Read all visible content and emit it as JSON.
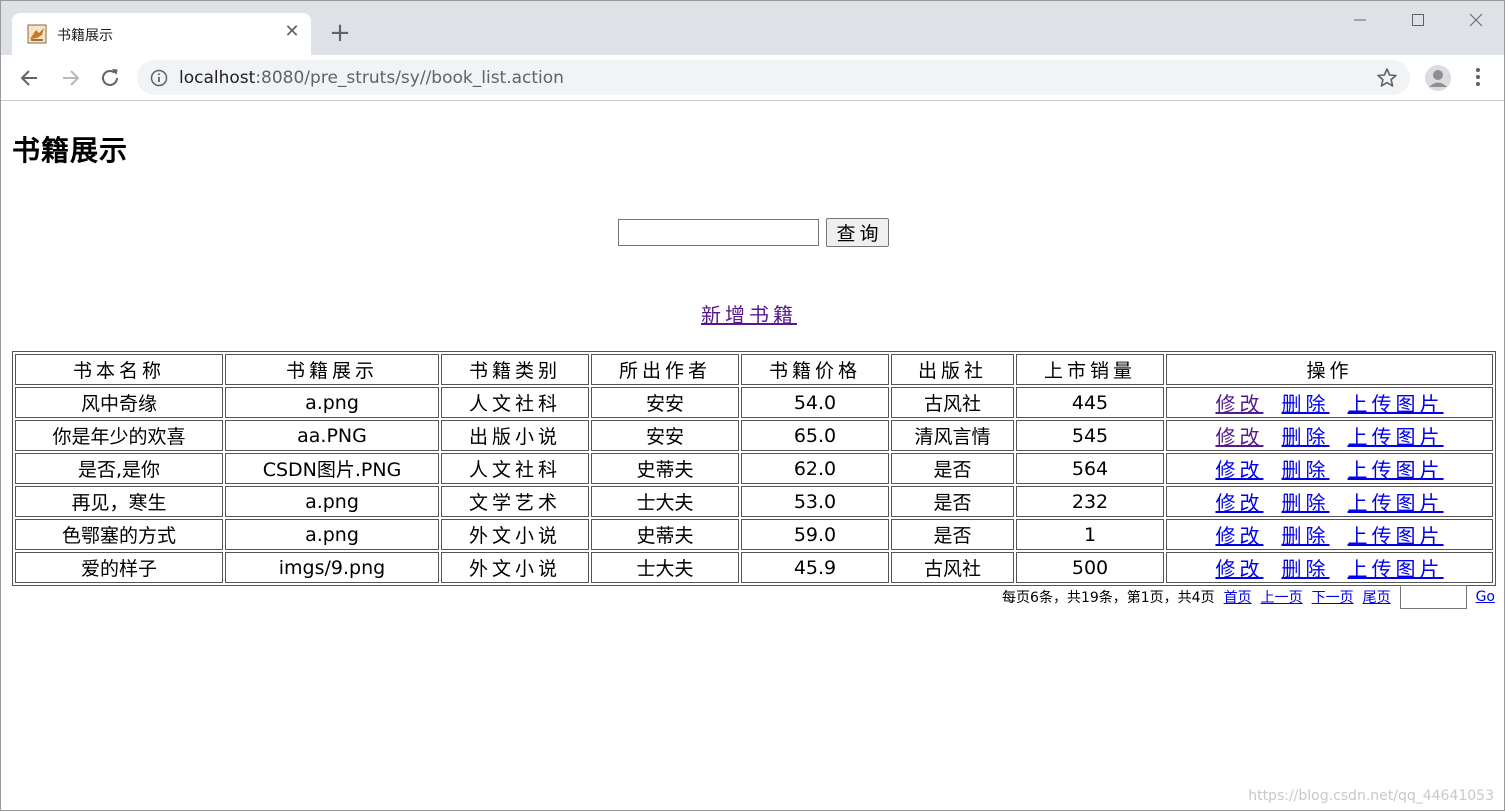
{
  "browser": {
    "tab_title": "书籍展示",
    "new_tab_glyph": "+",
    "url_host": "localhost",
    "url_rest": ":8080/pre_struts/sy//book_list.action"
  },
  "page": {
    "title": "书籍展示",
    "search_button": "查询",
    "add_link": "新增书籍",
    "table": {
      "headers": [
        "书本名称",
        "书籍展示",
        "书籍类别",
        "所出作者",
        "书籍价格",
        "出版社",
        "上市销量",
        "操作"
      ],
      "rows": [
        {
          "name": "风中奇缘",
          "image": "a.png",
          "category": "人文社科",
          "author": "安安",
          "price": "54.0",
          "publisher": "古风社",
          "sales": "445"
        },
        {
          "name": "你是年少的欢喜",
          "image": "aa.PNG",
          "category": "出版小说",
          "author": "安安",
          "price": "65.0",
          "publisher": "清风言情",
          "sales": "545"
        },
        {
          "name": "是否,是你",
          "image": "CSDN图片.PNG",
          "category": "人文社科",
          "author": "史蒂夫",
          "price": "62.0",
          "publisher": "是否",
          "sales": "564"
        },
        {
          "name": "再见，寒生",
          "image": "a.png",
          "category": "文学艺术",
          "author": "士大夫",
          "price": "53.0",
          "publisher": "是否",
          "sales": "232"
        },
        {
          "name": "色鄂塞的方式",
          "image": "a.png",
          "category": "外文小说",
          "author": "史蒂夫",
          "price": "59.0",
          "publisher": "是否",
          "sales": "1"
        },
        {
          "name": "爱的样子",
          "image": "imgs/9.png",
          "category": "外文小说",
          "author": "士大夫",
          "price": "45.9",
          "publisher": "古风社",
          "sales": "500"
        }
      ],
      "ops": {
        "edit": "修改",
        "delete": "删除",
        "upload": "上传图片"
      }
    },
    "pager": {
      "summary": "每页6条，共19条，第1页，共4页",
      "first": "首页",
      "prev": "上一页",
      "next": "下一页",
      "last": "尾页",
      "go": "Go"
    }
  },
  "watermark": "https://blog.csdn.net/qq_44641053",
  "colors": {
    "visited_link": "#551a8b",
    "link": "#0000ee",
    "tabstrip": "#dee1e6"
  }
}
